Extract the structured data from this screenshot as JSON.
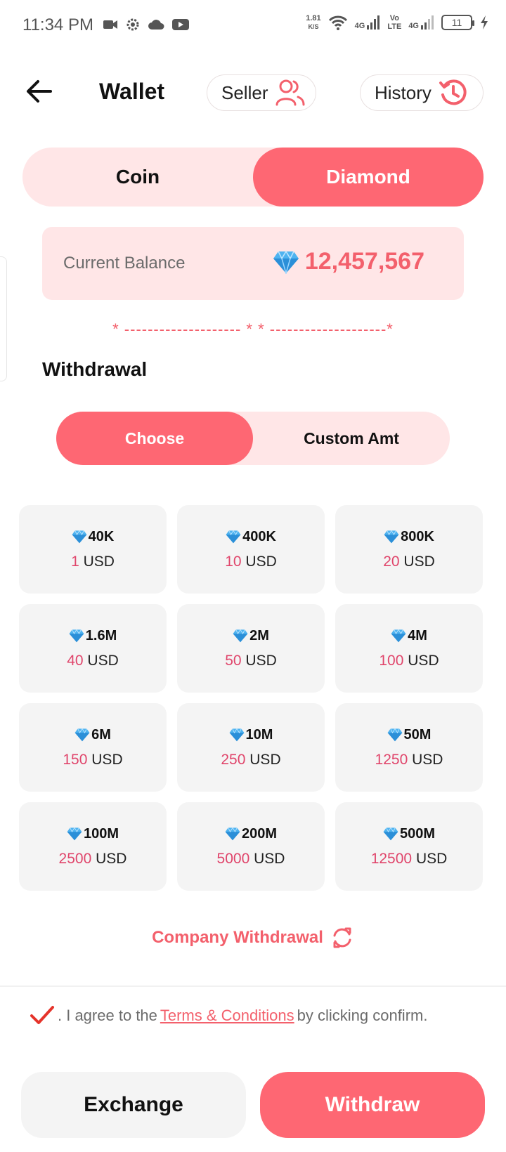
{
  "status_bar": {
    "time": "11:34 PM",
    "net_speed_value": "1.81",
    "net_speed_unit": "K/S",
    "signal1_label": "4G",
    "volte_label_top": "Vo",
    "volte_label_bottom": "LTE",
    "signal2_label": "4G",
    "battery_level": "11",
    "icons": [
      "video-camera-icon",
      "gear-icon",
      "cloud-icon",
      "youtube-icon",
      "wifi-icon",
      "signal-icon",
      "battery-icon",
      "charging-icon"
    ]
  },
  "header": {
    "title": "Wallet",
    "seller_label": "Seller",
    "history_label": "History"
  },
  "currency_tabs": {
    "coin_label": "Coin",
    "diamond_label": "Diamond",
    "selected": "Diamond"
  },
  "balance": {
    "label": "Current Balance",
    "value": "12,457,567"
  },
  "decor_divider": "* -------------------- * * --------------------*",
  "withdrawal": {
    "title": "Withdrawal",
    "mode_choose_label": "Choose",
    "mode_custom_label": "Custom Amt",
    "selected_mode": "Choose",
    "currency_label": "USD",
    "options": [
      {
        "diamonds": "40K",
        "amount": "1"
      },
      {
        "diamonds": "400K",
        "amount": "10"
      },
      {
        "diamonds": "800K",
        "amount": "20"
      },
      {
        "diamonds": "1.6M",
        "amount": "40"
      },
      {
        "diamonds": "2M",
        "amount": "50"
      },
      {
        "diamonds": "4M",
        "amount": "100"
      },
      {
        "diamonds": "6M",
        "amount": "150"
      },
      {
        "diamonds": "10M",
        "amount": "250"
      },
      {
        "diamonds": "50M",
        "amount": "1250"
      },
      {
        "diamonds": "100M",
        "amount": "2500"
      },
      {
        "diamonds": "200M",
        "amount": "5000"
      },
      {
        "diamonds": "500M",
        "amount": "12500"
      }
    ]
  },
  "company_withdrawal_label": "Company Withdrawal",
  "agreement": {
    "prefix": ". I agree to the",
    "link": "Terms & Conditions",
    "suffix": "by clicking confirm.",
    "checked": true
  },
  "actions": {
    "exchange_label": "Exchange",
    "withdraw_label": "Withdraw"
  },
  "colors": {
    "accent": "#fe6773",
    "accent_text": "#f3606c",
    "accent_soft": "#ffe6e7",
    "card_bg": "#f4f4f4",
    "amount_text": "#e0456b"
  }
}
